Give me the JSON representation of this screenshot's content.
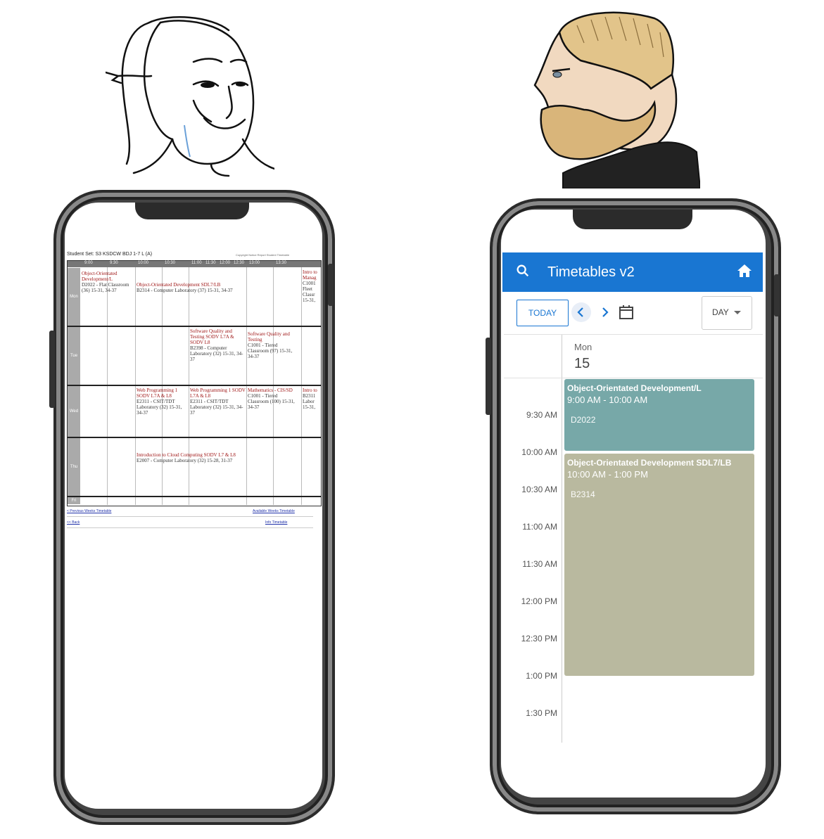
{
  "old_timetable": {
    "heading": "Student Set: S3 KSDCW BDJ 1-7 L (A)",
    "heading_right": "Copyright Notice  Report Student Timetable",
    "times": [
      "9:00",
      "9:30",
      "10:00",
      "10:30",
      "11:00",
      "11:30",
      "12:00",
      "12:30",
      "13:00",
      "13:30"
    ],
    "days": [
      "Mon",
      "Tue",
      "Wed",
      "Thu",
      "Fri"
    ],
    "cells": [
      {
        "title": "Object-Orientated Development/L",
        "body": "D2022 - Flat Classroom (36) 15-31, 34-37"
      },
      {
        "title": "Object-Orientated Development SDL7/LB",
        "body": "B2314 - Computer Laboratory (37) 15-31, 34-37"
      },
      {
        "title": "Intro to Manag",
        "body": "C1001 Fleet Classr 15-31,"
      },
      {
        "title": "Software Quality and Testing SODV L7A & SODV L8",
        "body": "B2398 - Computer Laboratory (32) 15-31, 34-37"
      },
      {
        "title": "Software Quality and Testing",
        "body": "C1001 - Tiered Classroom (97) 15-31, 34-37"
      },
      {
        "title": "Web Programming 1 SODV L7A & L8",
        "body": "E2311 - CSIT/TDT Laboratory (32) 15-31, 34-37"
      },
      {
        "title": "Web Programming 1 SODV L7A & L8",
        "body": "E2311 - CSIT/TDT Laboratory (32) 15-31, 34-37"
      },
      {
        "title": "Mathematics - CIS/SD",
        "body": "C1001 - Tiered Classroom (100) 15-31, 34-37"
      },
      {
        "title": "Intro to",
        "body": "B2311 Labor 15-31,"
      },
      {
        "title": "Introduction to Cloud Computing SODV L7 & L8",
        "body": "E2007 - Computer Laboratory (32) 15-28, 31-37"
      }
    ],
    "links": {
      "prev": "< Previous Weeks Timetable",
      "next": "Available Weeks Timetable",
      "back": "<< Back",
      "info": "Info Timetable"
    }
  },
  "new_app": {
    "title": "Timetables v2",
    "icons": [
      "search-icon",
      "home-icon",
      "chevron-left-icon",
      "chevron-right-icon",
      "calendar-icon",
      "dropdown-arrow-icon"
    ],
    "today_label": "TODAY",
    "view_label": "DAY",
    "day_name": "Mon",
    "day_number": "15",
    "time_slots": [
      "9:30 AM",
      "10:00 AM",
      "10:30 AM",
      "11:00 AM",
      "11:30 AM",
      "12:00 PM",
      "12:30 PM",
      "1:00 PM",
      "1:30 PM"
    ],
    "events": [
      {
        "title": "Object-Orientated Development/L",
        "time": "9:00 AM  -  10:00 AM",
        "location": "D2022",
        "color": "#77a8a8"
      },
      {
        "title": "Object-Orientated Development SDL7/LB",
        "time": "10:00 AM  -  1:00 PM",
        "location": "B2314",
        "color": "#b9b99f"
      }
    ],
    "accent_color": "#1976d2"
  }
}
